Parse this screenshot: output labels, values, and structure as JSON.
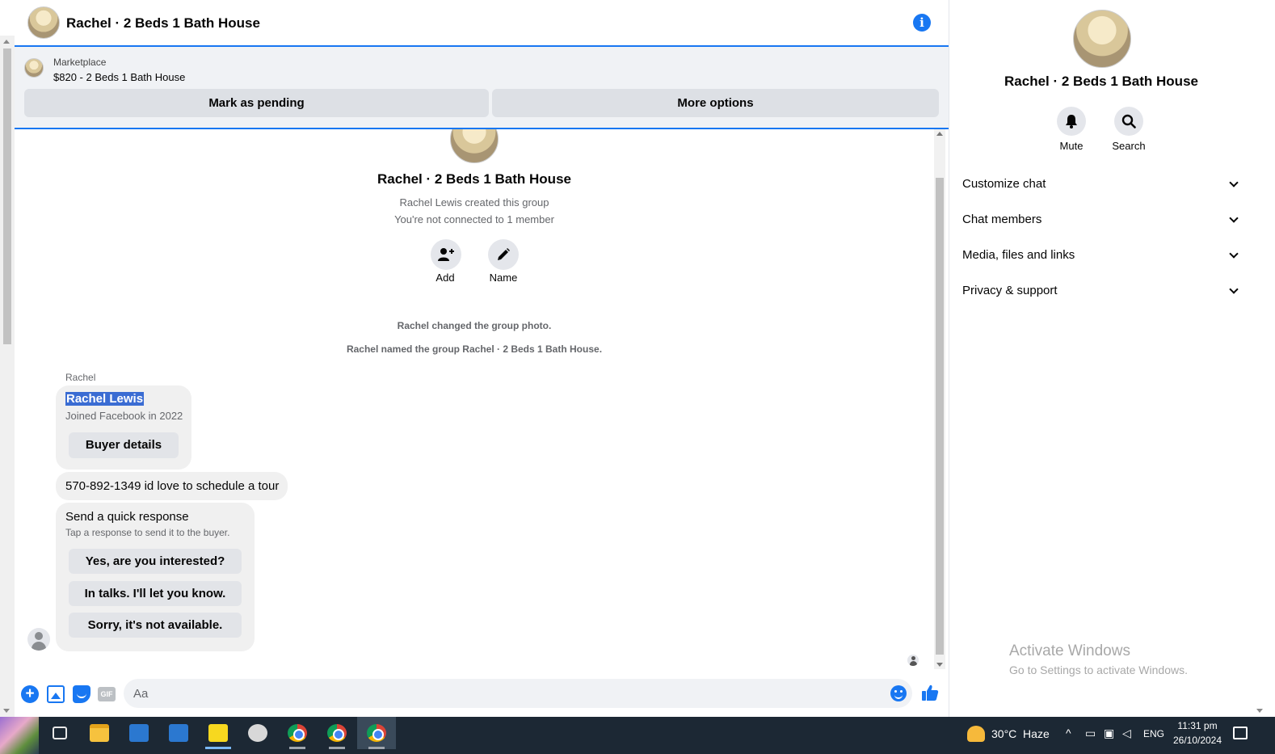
{
  "chat": {
    "title": "Rachel · 2 Beds 1 Bath House",
    "info_icon": "info-icon"
  },
  "marketplace": {
    "label": "Marketplace",
    "listing": "$820 - 2 Beds 1 Bath House",
    "mark_pending": "Mark as pending",
    "more_options": "More options"
  },
  "group": {
    "title": "Rachel · 2 Beds 1 Bath House",
    "created_by": "Rachel Lewis created this group",
    "connection": "You're not connected to 1 member",
    "add_label": "Add",
    "name_label": "Name"
  },
  "system_messages": [
    "Rachel changed the group photo.",
    "Rachel named the group Rachel · 2 Beds 1 Bath House."
  ],
  "messages": {
    "sender": "Rachel",
    "buyer_card": {
      "name": "Rachel Lewis",
      "joined": "Joined Facebook in 2022",
      "button": "Buyer details"
    },
    "text": "570-892-1349 id love to schedule a tour",
    "quick_response": {
      "heading": "Send a quick response",
      "subheading": "Tap a response to send it to the buyer.",
      "options": [
        "Yes, are you interested?",
        "In talks. I'll let you know.",
        "Sorry, it's not available."
      ]
    }
  },
  "composer": {
    "placeholder": "Aa",
    "gif_label": "GIF"
  },
  "panel": {
    "title": "Rachel · 2 Beds 1 Bath House",
    "mute_label": "Mute",
    "search_label": "Search",
    "sections": [
      "Customize chat",
      "Chat members",
      "Media, files and links",
      "Privacy & support"
    ]
  },
  "watermark": {
    "line1": "Activate Windows",
    "line2": "Go to Settings to activate Windows."
  },
  "taskbar": {
    "weather": "30°C  Haze",
    "language": "ENG",
    "time": "11:31 pm",
    "date": "26/10/2024"
  },
  "colors": {
    "accent": "#1877f2",
    "bubble": "#f0f0f0",
    "taskbar": "#1c2834"
  }
}
